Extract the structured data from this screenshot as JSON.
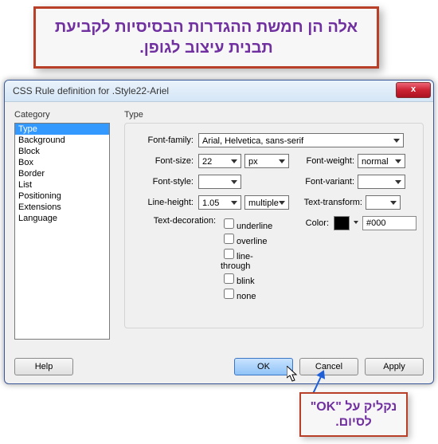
{
  "annotation_top": "אלה הן חמשת ההגדרות הבסיסיות לקביעת תבנית עיצוב לגופן.",
  "annotation_bottom": "נקליק על \"OK\" לסיום.",
  "dialog": {
    "title": "CSS Rule definition for .Style22-Ariel",
    "close_label": "x",
    "category_header": "Category",
    "type_header": "Type",
    "categories": [
      "Type",
      "Background",
      "Block",
      "Box",
      "Border",
      "List",
      "Positioning",
      "Extensions",
      "Language"
    ],
    "labels": {
      "font_family": "Font-family:",
      "font_size": "Font-size:",
      "font_weight": "Font-weight:",
      "font_style": "Font-style:",
      "font_variant": "Font-variant:",
      "line_height": "Line-height:",
      "text_transform": "Text-transform:",
      "text_decoration": "Text-decoration:",
      "color": "Color:"
    },
    "values": {
      "font_family": "Arial, Helvetica, sans-serif",
      "font_size": "22",
      "font_size_unit": "px",
      "font_weight": "normal",
      "font_style": "",
      "font_variant": "",
      "line_height": "1.05",
      "line_height_unit": "multiple",
      "text_transform": "",
      "color_hex": "#000"
    },
    "decorations": [
      "underline",
      "overline",
      "line-through",
      "blink",
      "none"
    ],
    "buttons": {
      "help": "Help",
      "ok": "OK",
      "cancel": "Cancel",
      "apply": "Apply"
    }
  }
}
